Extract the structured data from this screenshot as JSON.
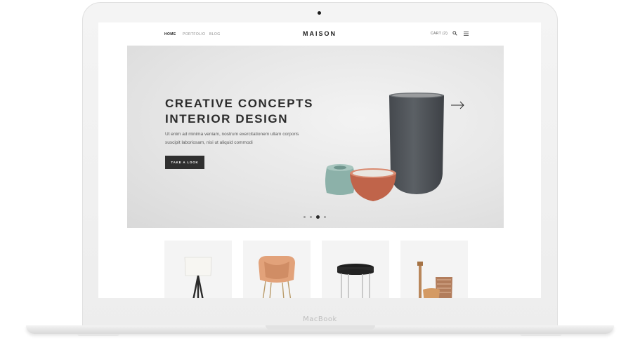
{
  "device": {
    "brand": "MacBook"
  },
  "nav": {
    "links": [
      "HOME",
      "PORTFOLIO",
      "BLOG"
    ],
    "active": "HOME",
    "logo": "MAISON",
    "cart": "CART (2)"
  },
  "hero": {
    "title_line1": "CREATIVE CONCEPTS",
    "title_line2": "INTERIOR DESIGN",
    "description": "Ut enim ad minima veniam, nostrum exercitationem ullam corporis suscipit laboriosam, nisi ut aliquid commodi",
    "button_label": "TAKE A LOOK",
    "slides_total": 4,
    "slide_active": 3
  },
  "products": [
    {
      "icon": "floor-lamp-icon"
    },
    {
      "icon": "armchair-icon"
    },
    {
      "icon": "side-table-icon"
    },
    {
      "icon": "vases-icon"
    }
  ],
  "colors": {
    "button": "#2f2f2f",
    "chair": "#e2a27a",
    "bowl": "#c0644a",
    "teal": "#8cb1a9",
    "vase": "#4f5358"
  }
}
